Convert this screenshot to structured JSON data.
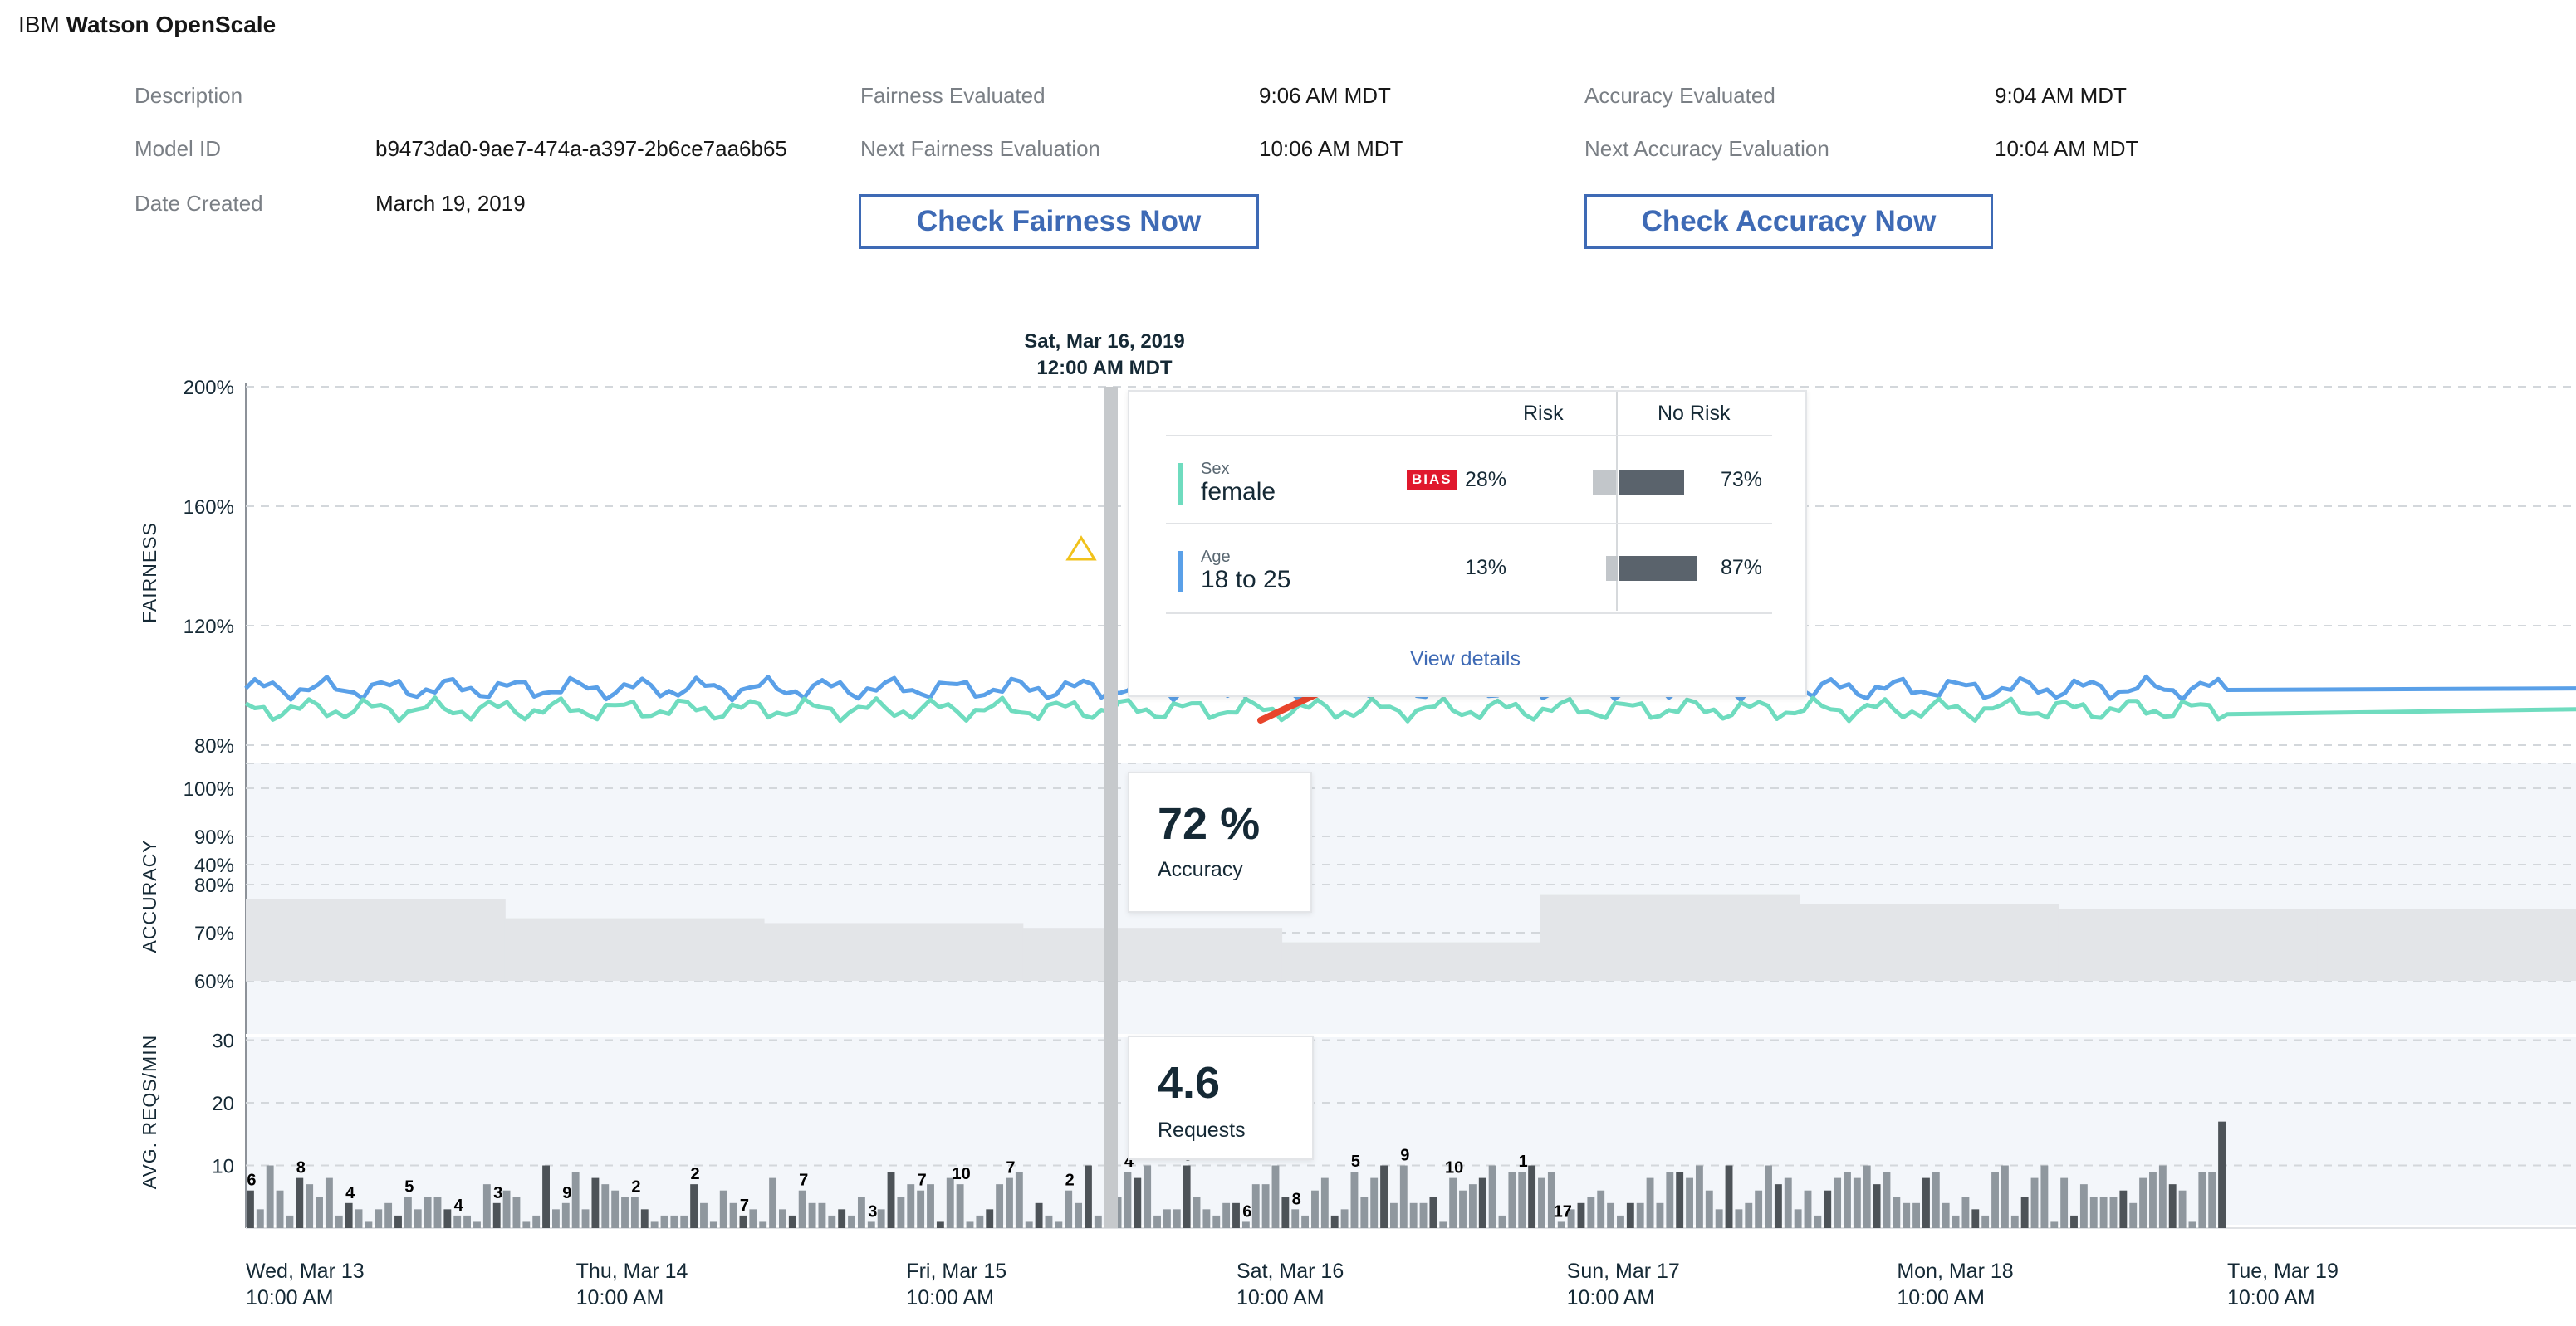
{
  "app": {
    "brand": "IBM",
    "product": "Watson OpenScale"
  },
  "meta": {
    "description_label": "Description",
    "model_id_label": "Model ID",
    "model_id": "b9473da0-9ae7-474a-a397-2b6ce7aa6b65",
    "date_created_label": "Date Created",
    "date_created": "March 19, 2019",
    "fairness_evaluated_label": "Fairness Evaluated",
    "fairness_evaluated": "9:06 AM MDT",
    "next_fairness_label": "Next Fairness Evaluation",
    "next_fairness": "10:06 AM MDT",
    "accuracy_evaluated_label": "Accuracy Evaluated",
    "accuracy_evaluated": "9:04 AM MDT",
    "next_accuracy_label": "Next Accuracy Evaluation",
    "next_accuracy": "10:04 AM MDT"
  },
  "buttons": {
    "check_fairness": "Check Fairness Now",
    "check_accuracy": "Check Accuracy Now"
  },
  "hover": {
    "date": "Sat, Mar 16, 2019",
    "time": "12:00 AM MDT"
  },
  "fairness_tooltip": {
    "col_risk": "Risk",
    "col_no_risk": "No Risk",
    "rows": [
      {
        "attribute": "Sex",
        "group": "female",
        "badge": "BIAS",
        "risk": "28%",
        "no_risk": "73%",
        "risk_fraction": 0.28,
        "no_risk_fraction": 0.73,
        "color": "#6fdcbf"
      },
      {
        "attribute": "Age",
        "group": "18 to 25",
        "badge": "",
        "risk": "13%",
        "no_risk": "87%",
        "risk_fraction": 0.13,
        "no_risk_fraction": 0.87,
        "color": "#5aa0e8"
      }
    ],
    "link": "View details"
  },
  "accuracy_tooltip": {
    "value": "72 %",
    "label": "Accuracy"
  },
  "requests_tooltip": {
    "value": "4.6",
    "label": "Requests"
  },
  "colors": {
    "accent": "#3e6ab5",
    "fairness_age": "#5aa0e8",
    "fairness_sex": "#6fdcbf",
    "bias": "#e0182d",
    "warning": "#f1c21b",
    "arrow": "#e8452c"
  },
  "chart_data": [
    {
      "type": "line",
      "ylabel": "FAIRNESS",
      "yticks": [
        "200%",
        "160%",
        "120%",
        "80%",
        "40%"
      ],
      "ylim": [
        0,
        200
      ],
      "series": [
        {
          "color": "#5aa0e8",
          "mean": 99,
          "amplitude": 4
        },
        {
          "color": "#6fdcbf",
          "mean": 92,
          "amplitude": 4
        }
      ]
    },
    {
      "type": "area",
      "ylabel": "ACCURACY",
      "yticks": [
        "100%",
        "90%",
        "80%",
        "70%",
        "60%"
      ],
      "ylim": [
        60,
        100
      ],
      "values": [
        77,
        73,
        72,
        71,
        68,
        78,
        76,
        75,
        75
      ]
    },
    {
      "type": "bar",
      "ylabel": "AVG. REQS/MIN",
      "yticks": [
        "30",
        "20",
        "10"
      ],
      "ylim": [
        0,
        30
      ],
      "x": [
        "Wed, Mar 13|10:00 AM",
        "Thu, Mar 14|10:00 AM",
        "Fri, Mar 15|10:00 AM",
        "Sat, Mar 16|10:00 AM",
        "Sun, Mar 17|10:00 AM",
        "Mon, Mar 18|10:00 AM",
        "Tue, Mar 19|10:00 AM"
      ],
      "values": [
        6,
        3,
        10,
        6,
        2,
        8,
        7,
        5,
        8,
        2,
        4,
        3,
        1,
        3,
        4,
        2,
        5,
        3,
        5,
        5,
        3,
        2,
        2,
        1,
        7,
        4,
        6,
        5,
        1,
        2,
        10,
        3,
        4,
        9,
        3,
        8,
        7,
        6,
        5,
        5,
        3,
        1,
        2,
        2,
        2,
        7,
        4,
        1,
        6,
        4,
        2,
        3,
        1,
        8,
        3,
        2,
        6,
        4,
        4,
        2,
        3,
        2,
        5,
        1,
        3,
        9,
        5,
        7,
        6,
        7,
        1,
        8,
        7,
        1,
        2,
        3,
        7,
        8,
        9,
        1,
        4,
        2,
        1,
        6,
        4,
        10,
        2,
        10,
        5,
        9,
        8,
        10,
        2,
        3,
        3,
        10,
        5,
        3,
        2,
        4,
        4,
        1,
        7,
        7,
        10,
        5,
        3,
        2,
        6,
        8,
        2,
        3,
        9,
        5,
        8,
        10,
        4,
        10,
        4,
        4,
        5,
        1,
        8,
        6,
        7,
        8,
        10,
        2,
        9,
        9,
        10,
        8,
        9,
        1,
        3,
        4,
        5,
        6,
        4,
        2,
        4,
        4,
        8,
        4,
        9,
        9,
        8,
        10,
        6,
        3,
        10,
        3,
        4,
        6,
        10,
        7,
        8,
        3,
        6,
        2,
        6,
        8,
        9,
        8,
        10,
        7,
        9,
        5,
        4,
        4,
        8,
        9,
        4,
        2,
        5,
        3,
        2,
        9,
        10,
        2,
        5,
        8,
        10,
        1,
        8,
        2,
        7,
        5,
        5,
        5,
        6,
        4,
        8,
        9,
        10,
        7,
        6,
        1,
        9,
        9,
        17
      ],
      "labels": [
        [
          0,
          "6"
        ],
        [
          5,
          "8"
        ],
        [
          10,
          "4"
        ],
        [
          16,
          "5"
        ],
        [
          21,
          "4"
        ],
        [
          25,
          "3"
        ],
        [
          32,
          "9"
        ],
        [
          39,
          "2"
        ],
        [
          45,
          "2"
        ],
        [
          50,
          "7"
        ],
        [
          56,
          "7"
        ],
        [
          63,
          "3"
        ],
        [
          68,
          "7"
        ],
        [
          72,
          "10"
        ],
        [
          77,
          "7"
        ],
        [
          83,
          "2"
        ],
        [
          89,
          "4"
        ],
        [
          95,
          "9"
        ],
        [
          101,
          "6"
        ],
        [
          106,
          "8"
        ],
        [
          112,
          "5"
        ],
        [
          117,
          "9"
        ],
        [
          122,
          "10"
        ],
        [
          129,
          "1"
        ],
        [
          133,
          "17"
        ]
      ]
    }
  ]
}
